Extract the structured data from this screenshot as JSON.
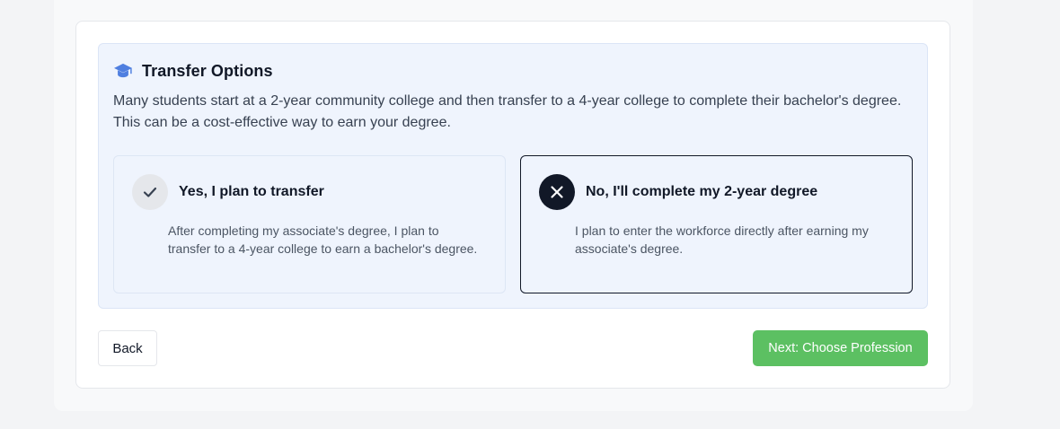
{
  "transfer": {
    "title": "Transfer Options",
    "icon": "graduation-cap-icon",
    "accent_color": "#4f7fe0",
    "description": "Many students start at a 2-year community college and then transfer to a 4-year college to complete their bachelor's degree. This can be a cost-effective way to earn your degree.",
    "options": [
      {
        "label": "Yes, I plan to transfer",
        "description": "After completing my associate's degree, I plan to transfer to a 4-year college to earn a bachelor's degree.",
        "icon": "check-icon",
        "selected": false
      },
      {
        "label": "No, I'll complete my 2-year degree",
        "description": "I plan to enter the workforce directly after earning my associate's degree.",
        "icon": "close-icon",
        "selected": true
      }
    ]
  },
  "nav": {
    "back_label": "Back",
    "next_label": "Next: Choose Profession",
    "next_color": "#5cc062"
  }
}
